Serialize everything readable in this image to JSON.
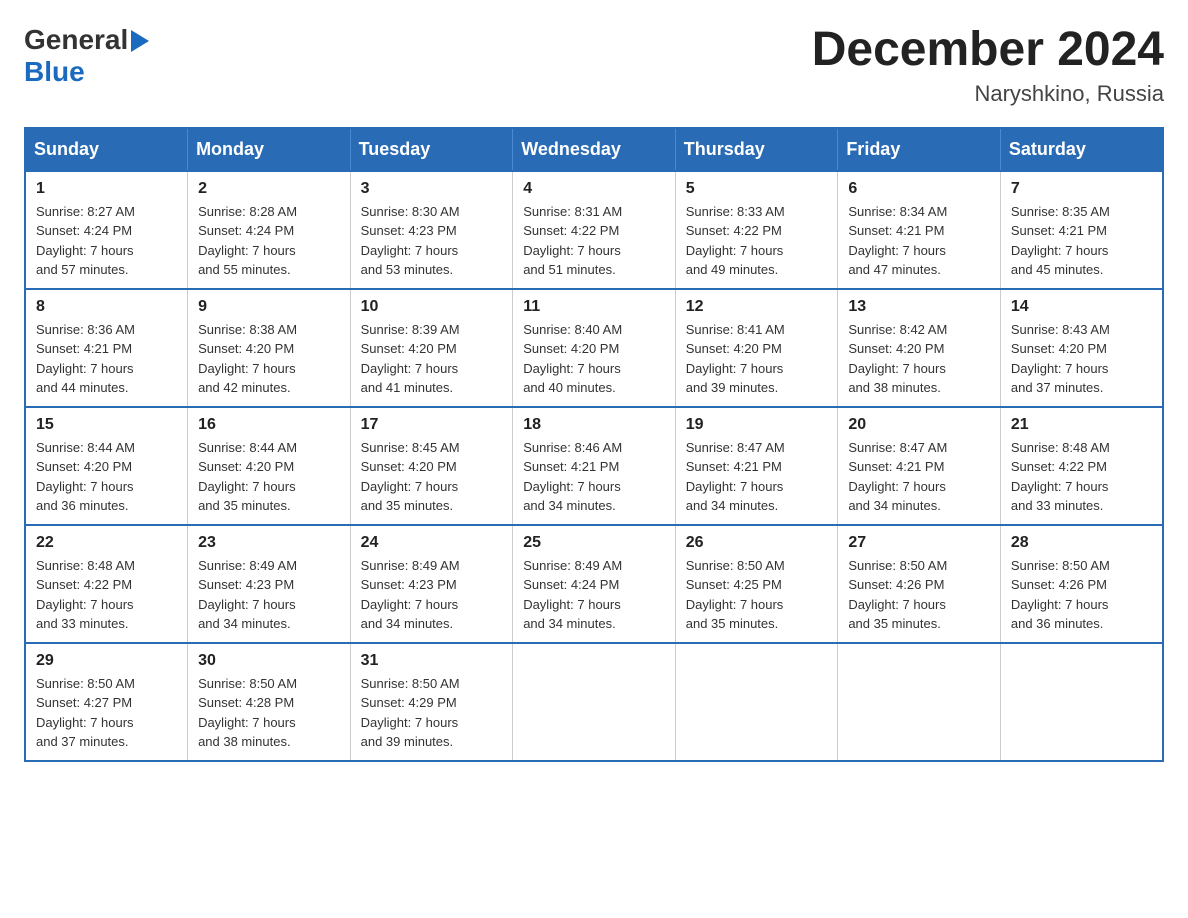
{
  "header": {
    "logo_general": "General",
    "logo_blue": "Blue",
    "title": "December 2024",
    "subtitle": "Naryshkino, Russia"
  },
  "days_header": [
    "Sunday",
    "Monday",
    "Tuesday",
    "Wednesday",
    "Thursday",
    "Friday",
    "Saturday"
  ],
  "weeks": [
    [
      {
        "day": "1",
        "info": "Sunrise: 8:27 AM\nSunset: 4:24 PM\nDaylight: 7 hours\nand 57 minutes."
      },
      {
        "day": "2",
        "info": "Sunrise: 8:28 AM\nSunset: 4:24 PM\nDaylight: 7 hours\nand 55 minutes."
      },
      {
        "day": "3",
        "info": "Sunrise: 8:30 AM\nSunset: 4:23 PM\nDaylight: 7 hours\nand 53 minutes."
      },
      {
        "day": "4",
        "info": "Sunrise: 8:31 AM\nSunset: 4:22 PM\nDaylight: 7 hours\nand 51 minutes."
      },
      {
        "day": "5",
        "info": "Sunrise: 8:33 AM\nSunset: 4:22 PM\nDaylight: 7 hours\nand 49 minutes."
      },
      {
        "day": "6",
        "info": "Sunrise: 8:34 AM\nSunset: 4:21 PM\nDaylight: 7 hours\nand 47 minutes."
      },
      {
        "day": "7",
        "info": "Sunrise: 8:35 AM\nSunset: 4:21 PM\nDaylight: 7 hours\nand 45 minutes."
      }
    ],
    [
      {
        "day": "8",
        "info": "Sunrise: 8:36 AM\nSunset: 4:21 PM\nDaylight: 7 hours\nand 44 minutes."
      },
      {
        "day": "9",
        "info": "Sunrise: 8:38 AM\nSunset: 4:20 PM\nDaylight: 7 hours\nand 42 minutes."
      },
      {
        "day": "10",
        "info": "Sunrise: 8:39 AM\nSunset: 4:20 PM\nDaylight: 7 hours\nand 41 minutes."
      },
      {
        "day": "11",
        "info": "Sunrise: 8:40 AM\nSunset: 4:20 PM\nDaylight: 7 hours\nand 40 minutes."
      },
      {
        "day": "12",
        "info": "Sunrise: 8:41 AM\nSunset: 4:20 PM\nDaylight: 7 hours\nand 39 minutes."
      },
      {
        "day": "13",
        "info": "Sunrise: 8:42 AM\nSunset: 4:20 PM\nDaylight: 7 hours\nand 38 minutes."
      },
      {
        "day": "14",
        "info": "Sunrise: 8:43 AM\nSunset: 4:20 PM\nDaylight: 7 hours\nand 37 minutes."
      }
    ],
    [
      {
        "day": "15",
        "info": "Sunrise: 8:44 AM\nSunset: 4:20 PM\nDaylight: 7 hours\nand 36 minutes."
      },
      {
        "day": "16",
        "info": "Sunrise: 8:44 AM\nSunset: 4:20 PM\nDaylight: 7 hours\nand 35 minutes."
      },
      {
        "day": "17",
        "info": "Sunrise: 8:45 AM\nSunset: 4:20 PM\nDaylight: 7 hours\nand 35 minutes."
      },
      {
        "day": "18",
        "info": "Sunrise: 8:46 AM\nSunset: 4:21 PM\nDaylight: 7 hours\nand 34 minutes."
      },
      {
        "day": "19",
        "info": "Sunrise: 8:47 AM\nSunset: 4:21 PM\nDaylight: 7 hours\nand 34 minutes."
      },
      {
        "day": "20",
        "info": "Sunrise: 8:47 AM\nSunset: 4:21 PM\nDaylight: 7 hours\nand 34 minutes."
      },
      {
        "day": "21",
        "info": "Sunrise: 8:48 AM\nSunset: 4:22 PM\nDaylight: 7 hours\nand 33 minutes."
      }
    ],
    [
      {
        "day": "22",
        "info": "Sunrise: 8:48 AM\nSunset: 4:22 PM\nDaylight: 7 hours\nand 33 minutes."
      },
      {
        "day": "23",
        "info": "Sunrise: 8:49 AM\nSunset: 4:23 PM\nDaylight: 7 hours\nand 34 minutes."
      },
      {
        "day": "24",
        "info": "Sunrise: 8:49 AM\nSunset: 4:23 PM\nDaylight: 7 hours\nand 34 minutes."
      },
      {
        "day": "25",
        "info": "Sunrise: 8:49 AM\nSunset: 4:24 PM\nDaylight: 7 hours\nand 34 minutes."
      },
      {
        "day": "26",
        "info": "Sunrise: 8:50 AM\nSunset: 4:25 PM\nDaylight: 7 hours\nand 35 minutes."
      },
      {
        "day": "27",
        "info": "Sunrise: 8:50 AM\nSunset: 4:26 PM\nDaylight: 7 hours\nand 35 minutes."
      },
      {
        "day": "28",
        "info": "Sunrise: 8:50 AM\nSunset: 4:26 PM\nDaylight: 7 hours\nand 36 minutes."
      }
    ],
    [
      {
        "day": "29",
        "info": "Sunrise: 8:50 AM\nSunset: 4:27 PM\nDaylight: 7 hours\nand 37 minutes."
      },
      {
        "day": "30",
        "info": "Sunrise: 8:50 AM\nSunset: 4:28 PM\nDaylight: 7 hours\nand 38 minutes."
      },
      {
        "day": "31",
        "info": "Sunrise: 8:50 AM\nSunset: 4:29 PM\nDaylight: 7 hours\nand 39 minutes."
      },
      {
        "day": "",
        "info": ""
      },
      {
        "day": "",
        "info": ""
      },
      {
        "day": "",
        "info": ""
      },
      {
        "day": "",
        "info": ""
      }
    ]
  ]
}
